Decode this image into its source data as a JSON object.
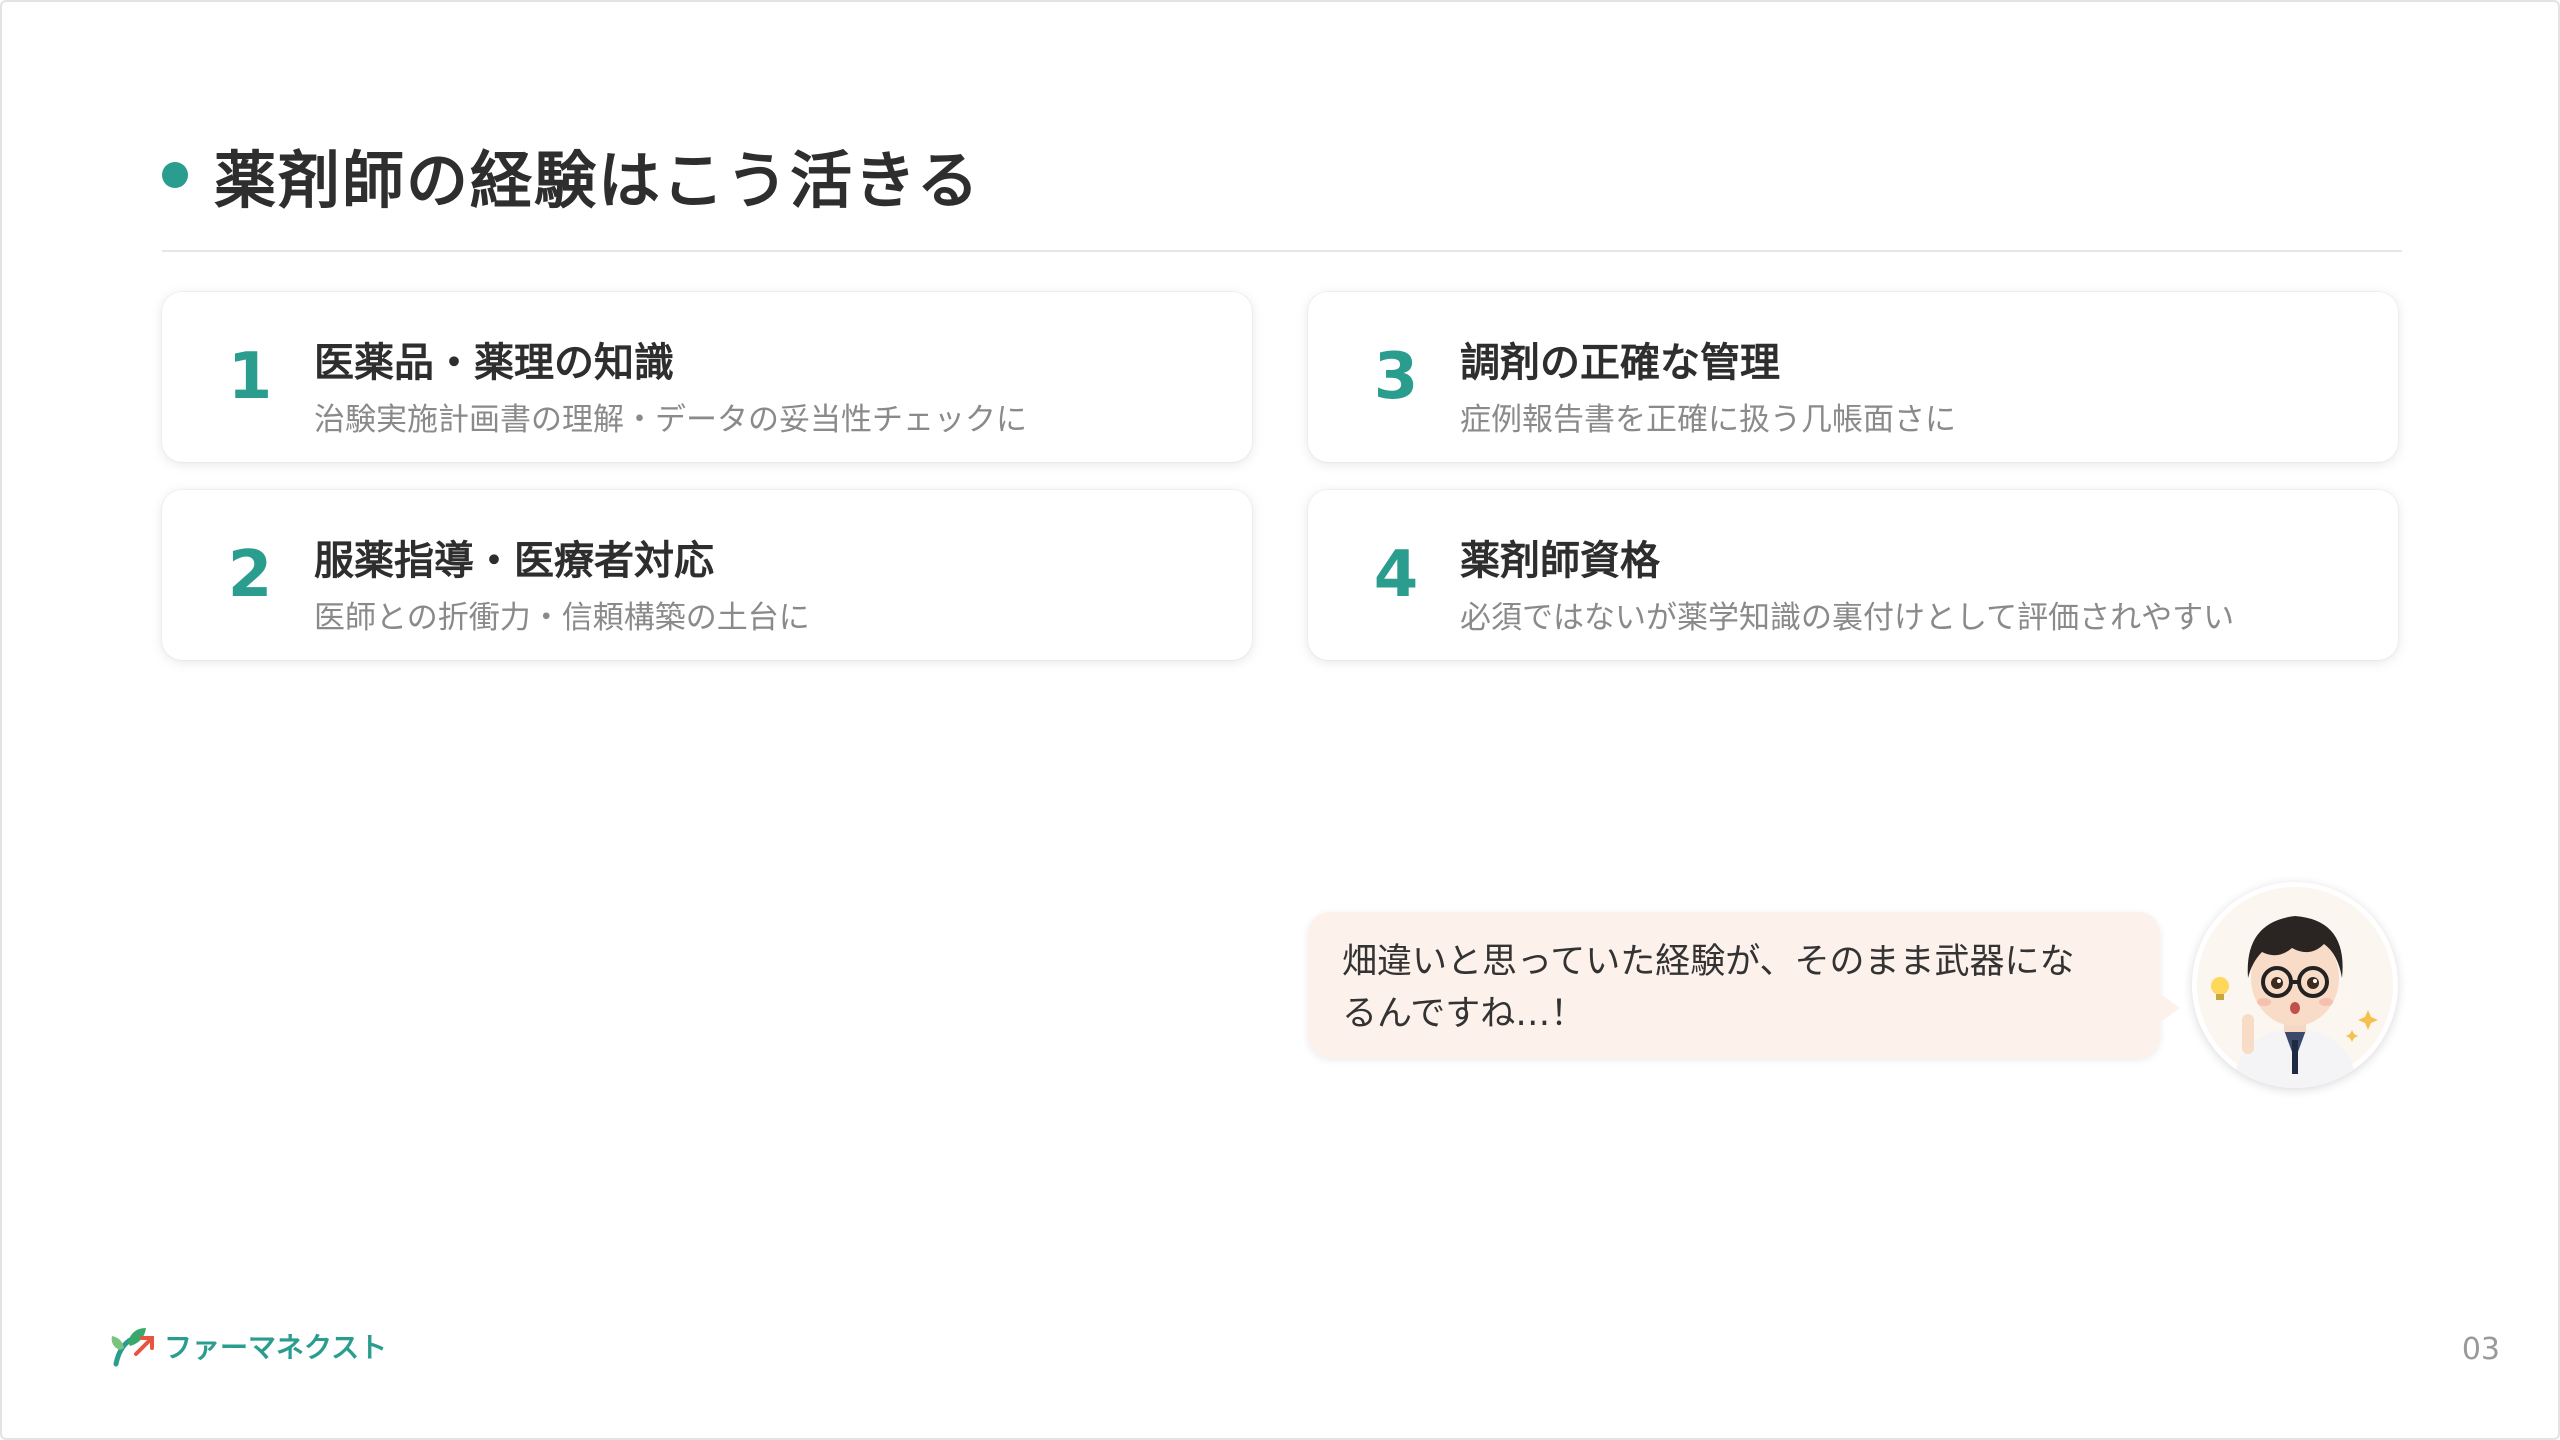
{
  "slide": {
    "title": "薬剤師の経験はこう活きる",
    "page_number": "03",
    "accent_color": "#2a9d8f"
  },
  "cards": [
    {
      "number": "1",
      "title": "医薬品・薬理の知識",
      "subtitle": "治験実施計画書の理解・データの妥当性チェックに"
    },
    {
      "number": "2",
      "title": "服薬指導・医療者対応",
      "subtitle": "医師との折衝力・信頼構築の土台に"
    },
    {
      "number": "3",
      "title": "調剤の正確な管理",
      "subtitle": "症例報告書を正確に扱う几帳面さに"
    },
    {
      "number": "4",
      "title": "薬剤師資格",
      "subtitle": "必須ではないが薬学知識の裏付けとして評価されやすい"
    }
  ],
  "bubble": {
    "line1": "畑違いと思っていた経験が、そのまま武器にな",
    "line2": "るんですね…！"
  },
  "avatar": {
    "icon": "pharmacist-avatar-icon"
  },
  "logo": {
    "text": "ファーマネクスト",
    "icon": "sprout-arrow-icon"
  }
}
